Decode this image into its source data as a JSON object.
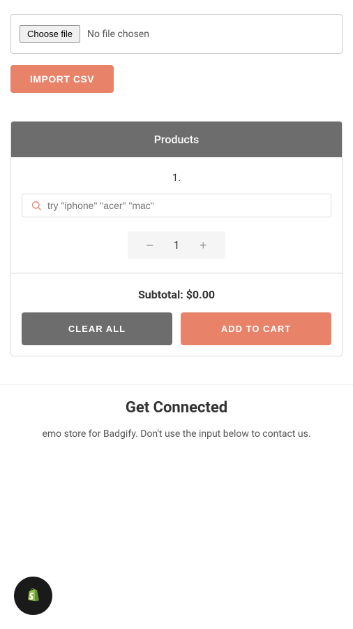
{
  "file_upload": {
    "choose_file_label": "Choose file",
    "no_file_label": "No file chosen",
    "import_btn_label": "IMPORT CSV"
  },
  "products_section": {
    "header_label": "Products",
    "product_number": "1.",
    "search_placeholder": "try \"iphone\" \"acer\" \"mac\"",
    "quantity_value": "1",
    "decrease_btn": "−",
    "increase_btn": "+"
  },
  "subtotal_section": {
    "subtotal_label": "Subtotal: ",
    "subtotal_value": "$0.00",
    "clear_all_label": "CLEAR ALL",
    "add_to_cart_label": "ADD TO CART"
  },
  "get_connected": {
    "title": "Get Connected",
    "description": "emo store for Badgify. Don't use the input below to contact us."
  },
  "shopify_badge": {
    "alt": "Shopify"
  }
}
